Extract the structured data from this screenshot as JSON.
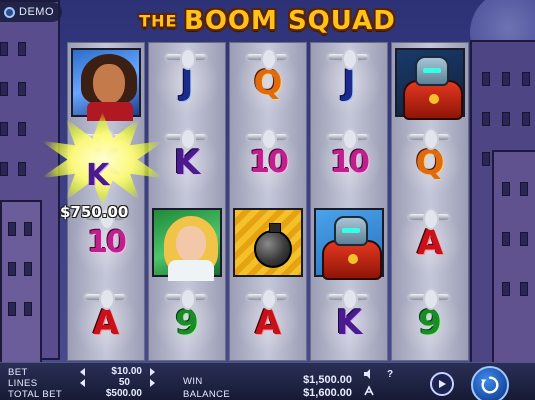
{
  "badge": {
    "label": "DEMO"
  },
  "title": {
    "prefix": "THE",
    "name": "BOOM SQUAD"
  },
  "reels": [
    [
      {
        "type": "hero",
        "icon": "heroine-dark-hair-icon"
      },
      {
        "type": "card",
        "label": "K",
        "icon": "card-k-icon"
      },
      {
        "type": "card",
        "label": "10",
        "icon": "card-ten-icon"
      },
      {
        "type": "card",
        "label": "A",
        "icon": "card-a-icon"
      }
    ],
    [
      {
        "type": "card",
        "label": "J",
        "icon": "card-j-icon"
      },
      {
        "type": "card",
        "label": "K",
        "icon": "card-k-icon"
      },
      {
        "type": "hero",
        "icon": "heroine-blonde-icon"
      },
      {
        "type": "card",
        "label": "9",
        "icon": "card-nine-icon"
      }
    ],
    [
      {
        "type": "card",
        "label": "Q",
        "icon": "card-q-icon"
      },
      {
        "type": "card",
        "label": "10",
        "icon": "card-ten-icon"
      },
      {
        "type": "bonus",
        "icon": "bomb-icon"
      },
      {
        "type": "card",
        "label": "A",
        "icon": "card-a-icon"
      }
    ],
    [
      {
        "type": "card",
        "label": "J",
        "icon": "card-j-icon"
      },
      {
        "type": "card",
        "label": "10",
        "icon": "card-ten-icon"
      },
      {
        "type": "hero",
        "icon": "robot-icon"
      },
      {
        "type": "card",
        "label": "K",
        "icon": "card-k-icon"
      }
    ],
    [
      {
        "type": "hero",
        "icon": "robot-icon"
      },
      {
        "type": "card",
        "label": "Q",
        "icon": "card-q-icon"
      },
      {
        "type": "card",
        "label": "A",
        "icon": "card-a-icon"
      },
      {
        "type": "card",
        "label": "9",
        "icon": "card-nine-icon"
      }
    ]
  ],
  "win_highlight": {
    "symbol": "K",
    "amount": "$750.00"
  },
  "controls": {
    "bet_label": "BET",
    "bet_value": "$10.00",
    "lines_label": "LINES",
    "lines_value": "50",
    "total_bet_label": "TOTAL BET",
    "total_bet_value": "$500.00",
    "win_label": "WIN",
    "win_value": "$1,500.00",
    "balance_label": "BALANCE",
    "balance_value": "$1,600.00",
    "help_label": "?"
  },
  "colors": {
    "title": "#ffc21a",
    "spin_button": "#1b4fa8",
    "card_j": "#1b2a8c",
    "card_q": "#e06a10",
    "card_k": "#4a1b8c",
    "card_ten": "#c0208c",
    "card_a": "#c8111b",
    "card_nine": "#1a8a2a"
  }
}
